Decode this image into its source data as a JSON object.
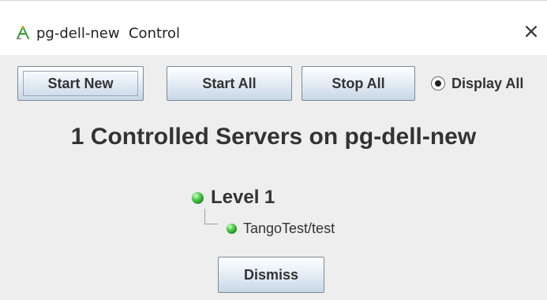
{
  "window": {
    "title": "pg-dell-new  Control",
    "close_glyph": "×",
    "icon": "tango-starter-icon"
  },
  "toolbar": {
    "start_new_label": "Start New",
    "start_all_label": "Start All",
    "stop_all_label": "Stop All",
    "display_all_label": "Display All",
    "display_all_selected": true
  },
  "main": {
    "heading": "1 Controlled Servers on pg-dell-new",
    "levels": [
      {
        "label": "Level 1",
        "status_color": "#2fb52f",
        "servers": [
          {
            "label": "TangoTest/test",
            "status_color": "#2fb52f"
          }
        ]
      }
    ]
  },
  "footer": {
    "dismiss_label": "Dismiss"
  }
}
